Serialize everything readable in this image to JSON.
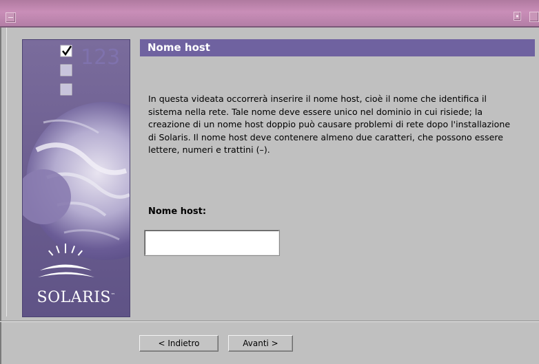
{
  "window": {
    "title": ""
  },
  "sidebar": {
    "logo_number": "123",
    "logo_text": "SOLARIS",
    "logo_tm": "™"
  },
  "panel": {
    "title": "Nome host",
    "description": "In questa videata occorrerà inserire il nome host, cioè il nome che identifica il sistema nella rete. Tale nome deve essere unico nel dominio in cui risiede; la creazione di un nome host doppio può causare problemi di rete dopo l'installazione di Solaris.  Il nome host deve contenere almeno due caratteri, che possono essere lettere, numeri e trattini (–).",
    "field_label": "Nome host:",
    "field_value": ""
  },
  "buttons": {
    "back_label": "< Indietro",
    "next_label": "Avanti >"
  },
  "colors": {
    "titlebar": "#c98eb8",
    "header": "#6f62a0",
    "background": "#c0c0c0"
  }
}
